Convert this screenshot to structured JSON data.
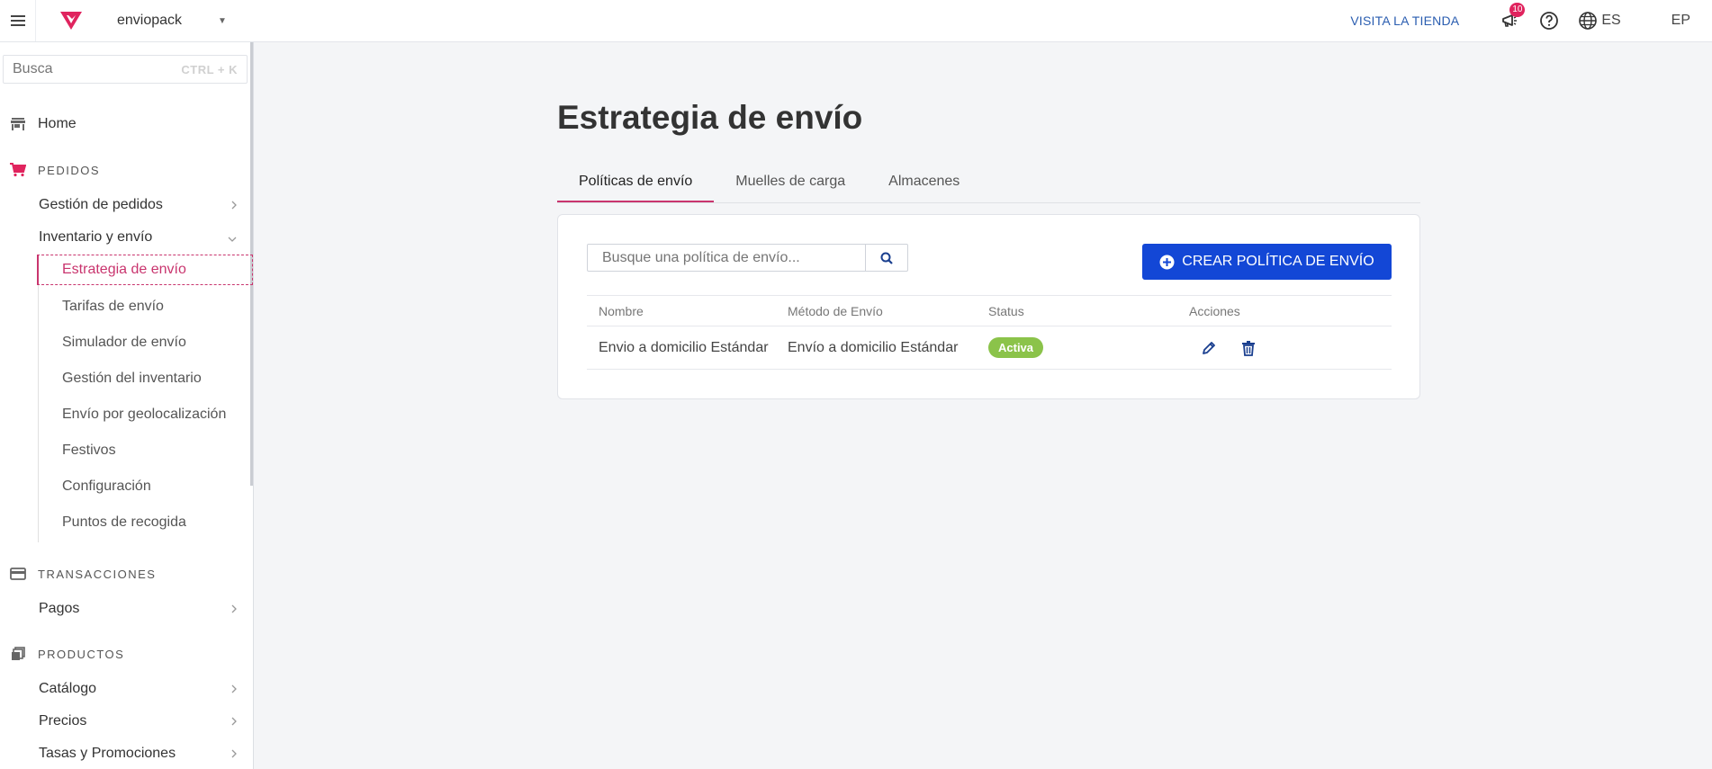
{
  "header": {
    "store_name": "enviopack",
    "visit_store": "VISITA LA TIENDA",
    "notifications_count": "10",
    "language": "ES",
    "user_initials": "EP",
    "brand_color": "#e0245e"
  },
  "sidebar": {
    "search_placeholder": "Busca",
    "search_shortcut": "CTRL + K",
    "home": "Home",
    "sections": {
      "orders": "PEDIDOS",
      "transactions": "TRANSACCIONES",
      "products": "PRODUCTOS"
    },
    "orders_items": {
      "order_management": "Gestión de pedidos",
      "inventory_shipping": "Inventario y envío"
    },
    "inventory_children": [
      "Estrategia de envío",
      "Tarifas de envío",
      "Simulador de envío",
      "Gestión del inventario",
      "Envío por geolocalización",
      "Festivos",
      "Configuración",
      "Puntos de recogida"
    ],
    "transactions_items": {
      "payments": "Pagos"
    },
    "products_items": {
      "catalog": "Catálogo",
      "prices": "Precios",
      "taxes_promotions": "Tasas y Promociones"
    }
  },
  "main": {
    "title": "Estrategia de envío",
    "tabs": [
      {
        "label": "Políticas de envío",
        "active": true
      },
      {
        "label": "Muelles de carga",
        "active": false
      },
      {
        "label": "Almacenes",
        "active": false
      }
    ],
    "search_placeholder": "Busque una política de envío...",
    "create_button": "CREAR POLÍTICA DE ENVÍO",
    "table": {
      "columns": [
        "Nombre",
        "Método de Envío",
        "Status",
        "Acciones"
      ],
      "rows": [
        {
          "name": "Envio a domicilio Estándar",
          "method": "Envío a domicilio Estándar",
          "status": "Activa"
        }
      ]
    },
    "accent_color": "#1347d6",
    "status_color": "#8bc34a"
  }
}
